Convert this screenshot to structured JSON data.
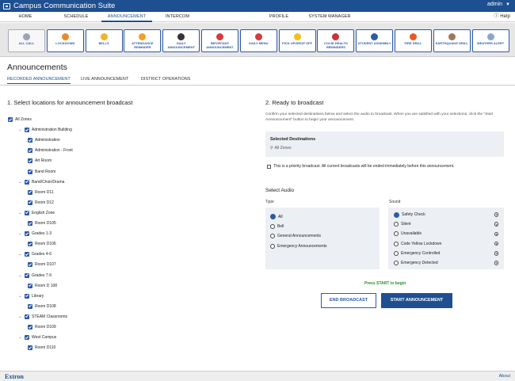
{
  "app": {
    "title": "Campus Communication Suite",
    "user": "admin",
    "help": "Help"
  },
  "nav": [
    "HOME",
    "SCHEDULE",
    "ANNOUNCEMENT",
    "INTERCOM",
    "PROFILE",
    "SYSTEM MANAGER"
  ],
  "tiles": [
    {
      "label": "ALL CALL",
      "icon": "all-call-icon",
      "color": "#9aa4b8"
    },
    {
      "label": "LOCKDOWN",
      "icon": "lockdown-icon",
      "color": "#e8892b"
    },
    {
      "label": "BELLS",
      "icon": "bell-icon",
      "color": "#f0b42a"
    },
    {
      "label": "ATTENDANCE REMINDER",
      "icon": "attendance-icon",
      "color": "#f0a030"
    },
    {
      "label": "DAILY ANNOUNCEMENT",
      "icon": "microphone-icon",
      "color": "#333333"
    },
    {
      "label": "IMPORTANT ANNOUNCEMENT",
      "icon": "important-icon",
      "color": "#d43b3b"
    },
    {
      "label": "DAILY MENU",
      "icon": "calendar-icon",
      "color": "#d43b3b"
    },
    {
      "label": "PICK UP/DROP OFF",
      "icon": "bus-icon",
      "color": "#f0c020"
    },
    {
      "label": "COVID HEALTH REMINDERS",
      "icon": "health-icon",
      "color": "#cc3333"
    },
    {
      "label": "STUDENT ASSEMBLY",
      "icon": "assembly-icon",
      "color": "#2d5aa8"
    },
    {
      "label": "FIRE DRILL",
      "icon": "fire-icon",
      "color": "#e85a20"
    },
    {
      "label": "EARTHQUAKE DRILL",
      "icon": "earthquake-icon",
      "color": "#9a7a5a"
    },
    {
      "label": "WEATHER ALERT",
      "icon": "weather-icon",
      "color": "#8aa8c8"
    }
  ],
  "page_title": "Announcements",
  "subtabs": [
    "RECORDED ANNOUNCEMENT",
    "LIVE ANNOUNCEMENT",
    "DISTRICT OPERATIONS"
  ],
  "section1": "1. Select locations for announcement broadcast",
  "tree": [
    {
      "label": "All Zones",
      "level": 0
    },
    {
      "label": "Administration Building",
      "level": 1
    },
    {
      "label": "Administration",
      "level": 2
    },
    {
      "label": "Administration - Front",
      "level": 2
    },
    {
      "label": "Art Room",
      "level": 2
    },
    {
      "label": "Band Room",
      "level": 2
    },
    {
      "label": "Band/Choir/Drama",
      "level": 1
    },
    {
      "label": "Room D11",
      "level": 2
    },
    {
      "label": "Room D12",
      "level": 2
    },
    {
      "label": "English Zone",
      "level": 1
    },
    {
      "label": "Room D105",
      "level": 2
    },
    {
      "label": "Grades 1-3",
      "level": 1
    },
    {
      "label": "Room D106",
      "level": 2
    },
    {
      "label": "Grades 4-6",
      "level": 1
    },
    {
      "label": "Room D107",
      "level": 2
    },
    {
      "label": "Grades 7-9",
      "level": 1
    },
    {
      "label": "Room D 108",
      "level": 2
    },
    {
      "label": "Library",
      "level": 1
    },
    {
      "label": "Room D108",
      "level": 2
    },
    {
      "label": "STEAM Classrooms",
      "level": 1
    },
    {
      "label": "Room D109",
      "level": 2
    },
    {
      "label": "West Campus",
      "level": 1
    },
    {
      "label": "Room D110",
      "level": 2
    }
  ],
  "section2": "2. Ready to broadcast",
  "section2_desc": "Confirm your selected destinations below and select the audio to broadcast. When you are satisfied with your selections, click the \"Start Announcement\" button to begin your announcement.",
  "destinations": {
    "title": "Selected Destinations",
    "value": "All Zones"
  },
  "priority_text": "This is a priority broadcast. All current broadcasts will be ended immediately before this announcement.",
  "select_audio": "Select Audio",
  "type_label": "Type",
  "sound_label": "Sound",
  "types": [
    "All",
    "Bell",
    "General Announcements",
    "Emergency Announcements"
  ],
  "sounds": [
    "Safety Check",
    "Silent",
    "Unavailable",
    "Code Yellow Lockdown",
    "Emergency Controlled",
    "Emergency Detected"
  ],
  "press_start": "Press START to begin",
  "end_button": "END BROADCAST",
  "start_button": "START ANNOUNCEMENT",
  "footer": {
    "brand": "Extron",
    "about": "About"
  }
}
